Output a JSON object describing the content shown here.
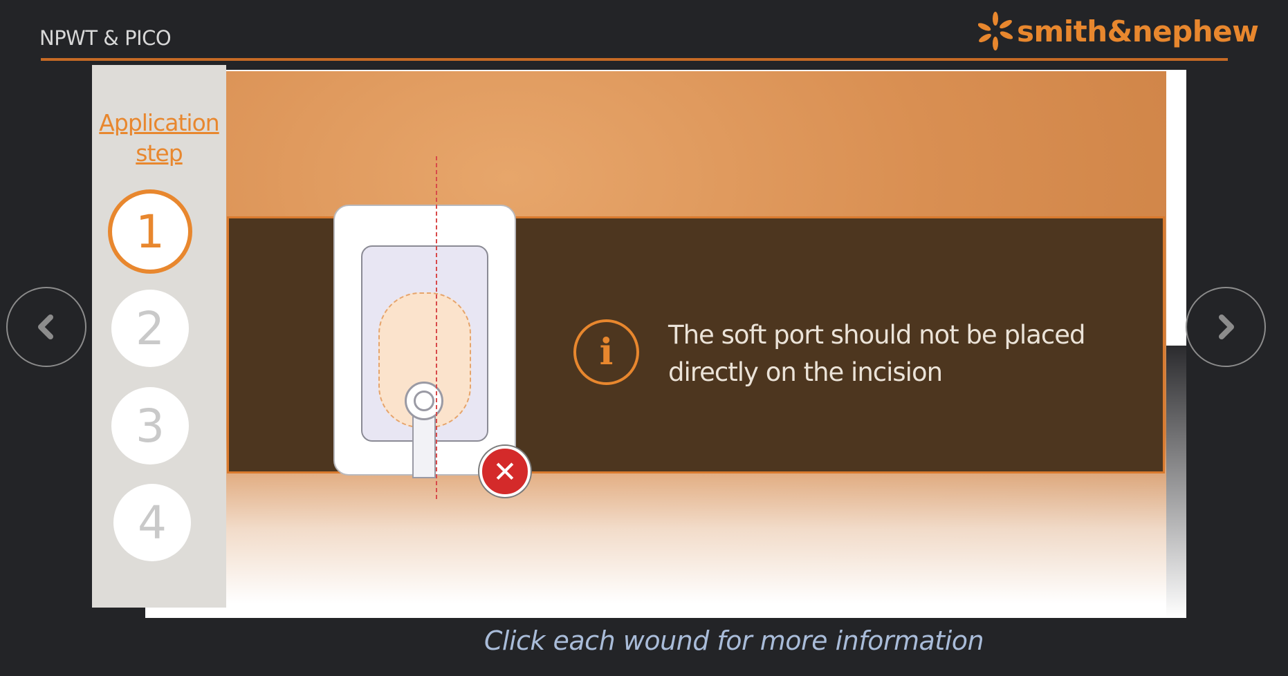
{
  "header": {
    "title": "NPWT & PICO",
    "logo_text": "smith&nephew"
  },
  "sidebar": {
    "title_line1": "Application",
    "title_line2": "step",
    "steps": [
      {
        "label": "1",
        "active": true
      },
      {
        "label": "2",
        "active": false
      },
      {
        "label": "3",
        "active": false
      },
      {
        "label": "4",
        "active": false
      }
    ]
  },
  "info": {
    "icon": "info-icon",
    "line1": "The soft port should not be placed",
    "line2": "directly on the incision"
  },
  "illustration": {
    "status_icon": "error-icon"
  },
  "nav": {
    "prev_icon": "chevron-left-icon",
    "next_icon": "chevron-right-icon"
  },
  "footer": {
    "hint": "Click each wound for more information"
  },
  "colors": {
    "accent": "#e8872e",
    "panel": "#4d361f",
    "background": "#232427",
    "error": "#d42a2a"
  }
}
